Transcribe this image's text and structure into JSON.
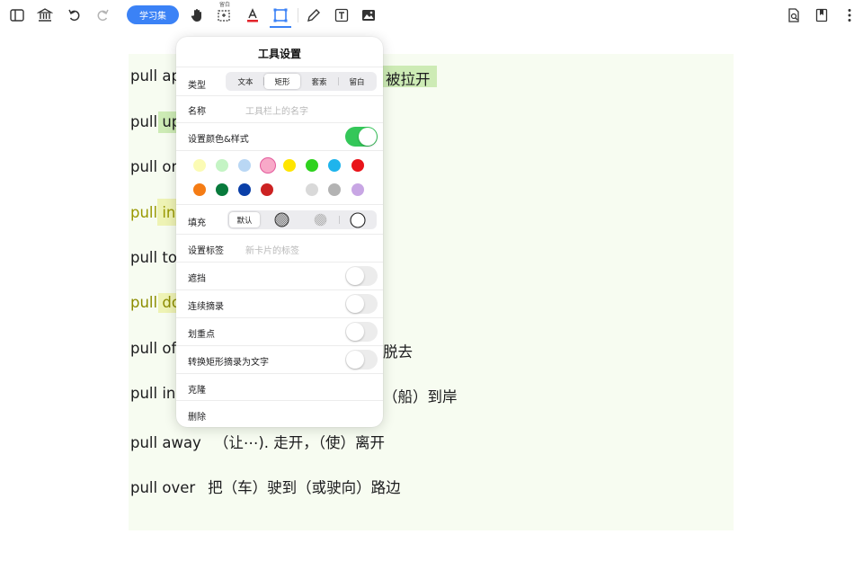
{
  "toolbar": {
    "study_button": "学习集",
    "frame_label": "留白"
  },
  "rows": [
    {
      "term": "pull ap",
      "meaning": "被拉开"
    },
    {
      "term": "pull up"
    },
    {
      "term": "pull on"
    },
    {
      "term": "pull int"
    },
    {
      "term": "pull tog"
    },
    {
      "term": "pull do"
    },
    {
      "term": "pull off",
      "meaning": "脱去"
    },
    {
      "term": "pull in",
      "meaning": "（船）到岸"
    },
    {
      "term": "pull away",
      "meaning": "（让⋯). 走开，（使）离开"
    },
    {
      "term": "pull over",
      "meaning": "把（车）驶到（或驶向）路边"
    }
  ],
  "panel": {
    "title": "工具设置",
    "type_label": "类型",
    "type_options": [
      "文本",
      "矩形",
      "套索",
      "留白"
    ],
    "type_selected": "矩形",
    "name_label": "名称",
    "name_placeholder": "工具栏上的名字",
    "color_style_label": "设置颜色&样式",
    "color_style_on": true,
    "colors_row1": [
      "#fbfbb4",
      "#c4f4c4",
      "#b9d7f4",
      "#f8a9c8",
      "#ffe500",
      "#2ed21e",
      "#1fb4ec",
      "#e9141a"
    ],
    "colors_row2": [
      "#f57c14",
      "#087a3c",
      "#0a3fa8",
      "#cc2222",
      "#d9d9d9",
      "#b3b3b3",
      "#c8a6e4"
    ],
    "selected_color": "#f8a9c8",
    "fill_label": "填充",
    "fill_default": "默认",
    "tag_label": "设置标签",
    "tag_placeholder": "新卡片的标签",
    "toggles": [
      {
        "label": "遮挡",
        "on": false
      },
      {
        "label": "连续摘录",
        "on": false
      },
      {
        "label": "划重点",
        "on": false
      },
      {
        "label": "转换矩形摘录为文字",
        "on": false
      }
    ],
    "clone_label": "克隆",
    "delete_label": "删除"
  }
}
